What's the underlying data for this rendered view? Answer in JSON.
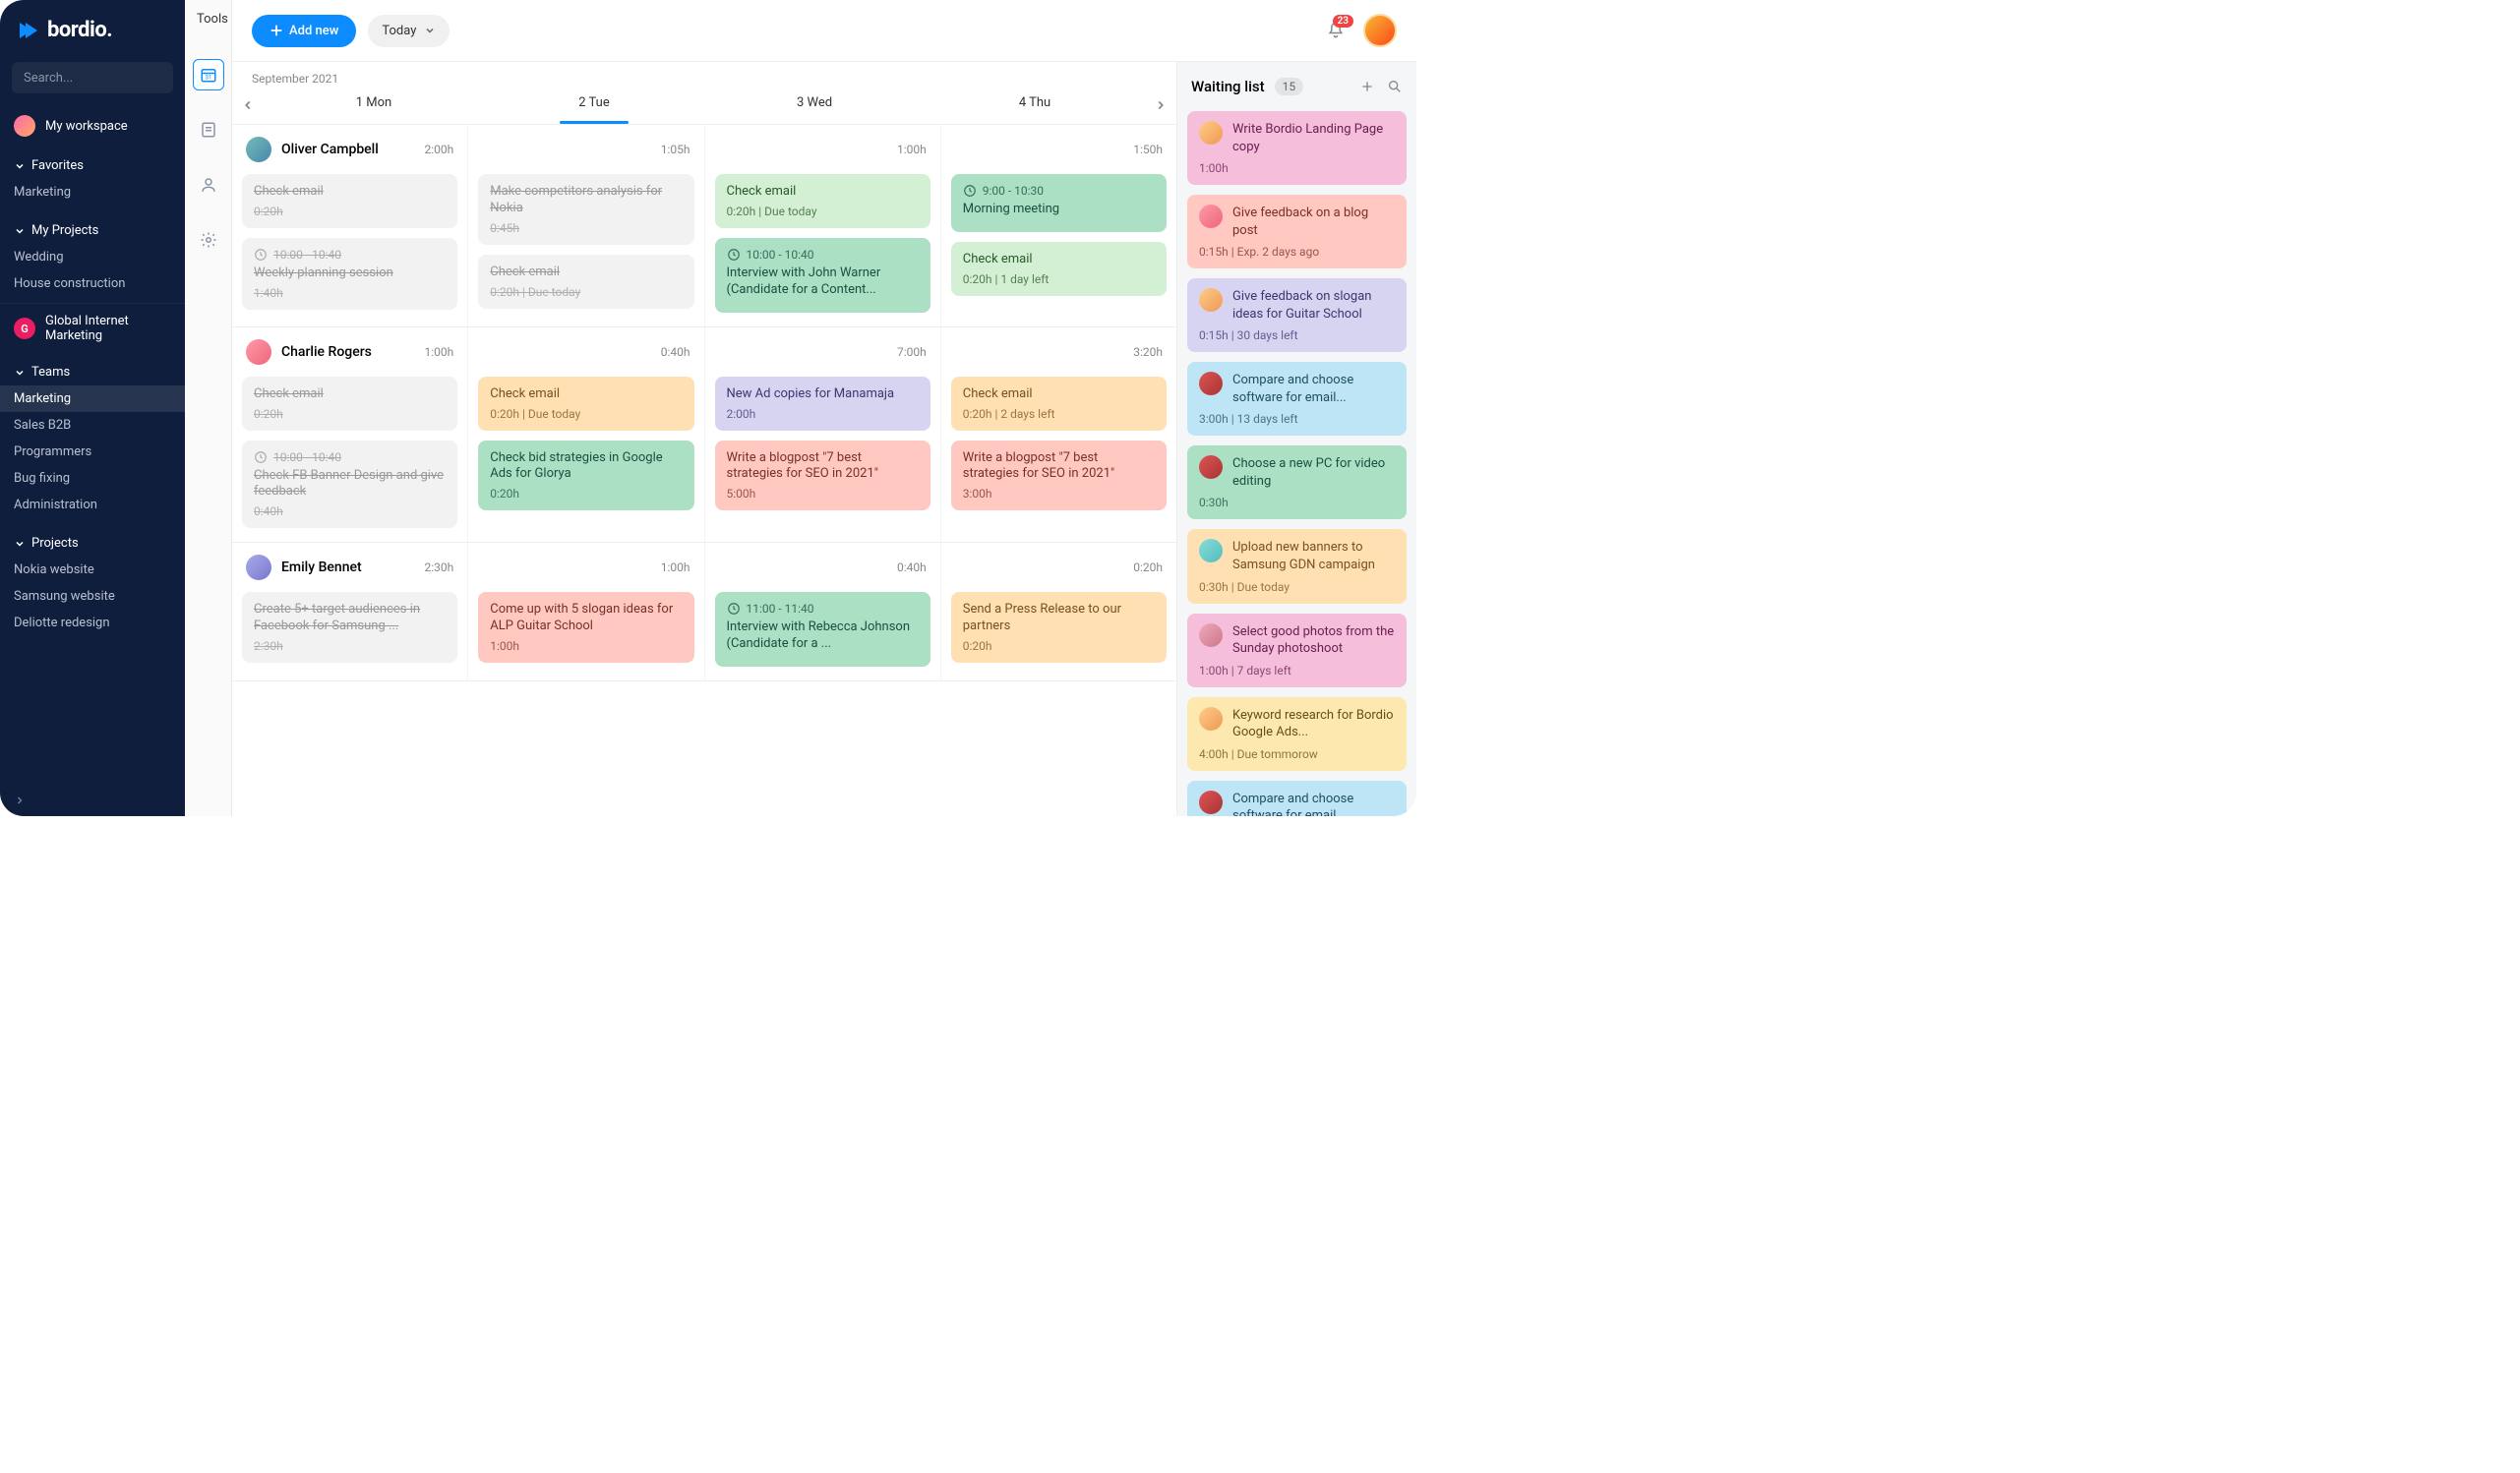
{
  "brand": {
    "name": "bordio."
  },
  "sidebar": {
    "search_placeholder": "Search...",
    "workspace": "My workspace",
    "favorites_label": "Favorites",
    "favorites": [
      "Marketing"
    ],
    "myprojects_label": "My Projects",
    "myprojects": [
      "Wedding",
      "House construction"
    ],
    "org": {
      "initial": "G",
      "name": "Global Internet Marketing"
    },
    "teams_label": "Teams",
    "teams": [
      "Marketing",
      "Sales B2B",
      "Programmers",
      "Bug fixing",
      "Administration"
    ],
    "teams_active_index": 0,
    "projects_label": "Projects",
    "projects": [
      "Nokia website",
      "Samsung website",
      "Deliotte redesign"
    ]
  },
  "tools_label": "Tools",
  "toolbar": {
    "add_label": "Add new",
    "today_label": "Today",
    "notifications_count": "23"
  },
  "calendar": {
    "month": "September 2021",
    "days": [
      "1 Mon",
      "2 Tue",
      "3 Wed",
      "4 Thu"
    ],
    "active_day_index": 1
  },
  "people": [
    {
      "name": "Oliver Campbell",
      "avatar_class": "av1",
      "hours": [
        "2:00h",
        "1:05h",
        "1:00h",
        "1:50h"
      ],
      "cols": [
        [
          {
            "title": "Check email",
            "meta": "0:20h",
            "color": "c-grey",
            "done": true
          },
          {
            "time": "10:00 - 10:40",
            "title": "Weekly planning session",
            "meta": "1:40h",
            "color": "c-grey",
            "done": true
          }
        ],
        [
          {
            "title": "Make competitors analysis for Nokia",
            "meta": "0:45h",
            "color": "c-grey",
            "done": true
          },
          {
            "title": "Check email",
            "meta": "0:20h | Due today",
            "color": "c-grey",
            "done": true
          }
        ],
        [
          {
            "title": "Check email",
            "meta": "0:20h | Due today",
            "color": "c-lgreen"
          },
          {
            "time": "10:00 - 10:40",
            "title": "Interview with John Warner (Candidate for a Content...",
            "color": "c-green"
          }
        ],
        [
          {
            "time": "9:00 - 10:30",
            "title": "Morning meeting",
            "color": "c-green"
          },
          {
            "title": "Check email",
            "meta": "0:20h | 1 day left",
            "color": "c-lgreen"
          }
        ]
      ]
    },
    {
      "name": "Charlie Rogers",
      "avatar_class": "av2",
      "hours": [
        "1:00h",
        "0:40h",
        "7:00h",
        "3:20h"
      ],
      "cols": [
        [
          {
            "title": "Check email",
            "meta": "0:20h",
            "color": "c-grey",
            "done": true
          },
          {
            "time": "10:00 - 10:40",
            "title": "Check FB Banner Design and give feedback",
            "meta": "0:40h",
            "color": "c-grey",
            "done": true
          }
        ],
        [
          {
            "title": "Check email",
            "meta": "0:20h | Due today",
            "color": "c-orange"
          },
          {
            "title": "Check bid strategies in Google Ads for Glorya",
            "meta": "0:20h",
            "color": "c-green"
          }
        ],
        [
          {
            "title": "New Ad copies for Manamaja",
            "meta": "2:00h",
            "color": "c-purple"
          },
          {
            "title": "Write a blogpost \"7 best strategies for SEO in 2021\"",
            "meta": "5:00h",
            "color": "c-red"
          }
        ],
        [
          {
            "title": "Check email",
            "meta": "0:20h | 2 days left",
            "color": "c-orange"
          },
          {
            "title": "Write a blogpost \"7 best strategies for SEO in 2021\"",
            "meta": "3:00h",
            "color": "c-red"
          }
        ]
      ]
    },
    {
      "name": "Emily Bennet",
      "avatar_class": "av3",
      "hours": [
        "2:30h",
        "1:00h",
        "0:40h",
        "0:20h"
      ],
      "cols": [
        [
          {
            "title": "Create 5+ target audiences in Facebook for Samsung ...",
            "meta": "2:30h",
            "color": "c-grey",
            "done": true
          }
        ],
        [
          {
            "title": "Come up with 5 slogan ideas for ALP Guitar School",
            "meta": "1:00h",
            "color": "c-red"
          }
        ],
        [
          {
            "time": "11:00 - 11:40",
            "title": "Interview with Rebecca Johnson (Candidate for a ...",
            "color": "c-green"
          }
        ],
        [
          {
            "title": "Send a Press Release to our partners",
            "meta": "0:20h",
            "color": "c-orange"
          }
        ]
      ]
    }
  ],
  "waiting": {
    "title": "Waiting list",
    "count": "15",
    "items": [
      {
        "title": "Write Bordio Landing Page copy",
        "meta": "1:00h",
        "color": "c-pink",
        "avatar": "av4"
      },
      {
        "title": "Give feedback on a blog post",
        "meta": "0:15h | Exp. 2 days ago",
        "color": "c-red",
        "avatar": "av2"
      },
      {
        "title": "Give feedback on slogan ideas for Guitar School",
        "meta": "0:15h | 30 days left",
        "color": "c-purple",
        "avatar": "av4"
      },
      {
        "title": "Compare and choose software for email...",
        "meta": "3:00h | 13 days left",
        "color": "c-blue",
        "avatar": "av5"
      },
      {
        "title": "Choose a new PC for video editing",
        "meta": "0:30h",
        "color": "c-green",
        "avatar": "av5"
      },
      {
        "title": "Upload new banners to Samsung GDN campaign",
        "meta": "0:30h | Due today",
        "color": "c-orange",
        "avatar": "av6"
      },
      {
        "title": "Select good photos from the Sunday photoshoot",
        "meta": "1:00h | 7 days left",
        "color": "c-pink",
        "avatar": "av7"
      },
      {
        "title": "Keyword research for Bordio Google Ads...",
        "meta": "4:00h | Due tommorow",
        "color": "c-yellow",
        "avatar": "av4"
      },
      {
        "title": "Compare and choose software for email...",
        "meta": "",
        "color": "c-blue",
        "avatar": "av5"
      }
    ]
  }
}
